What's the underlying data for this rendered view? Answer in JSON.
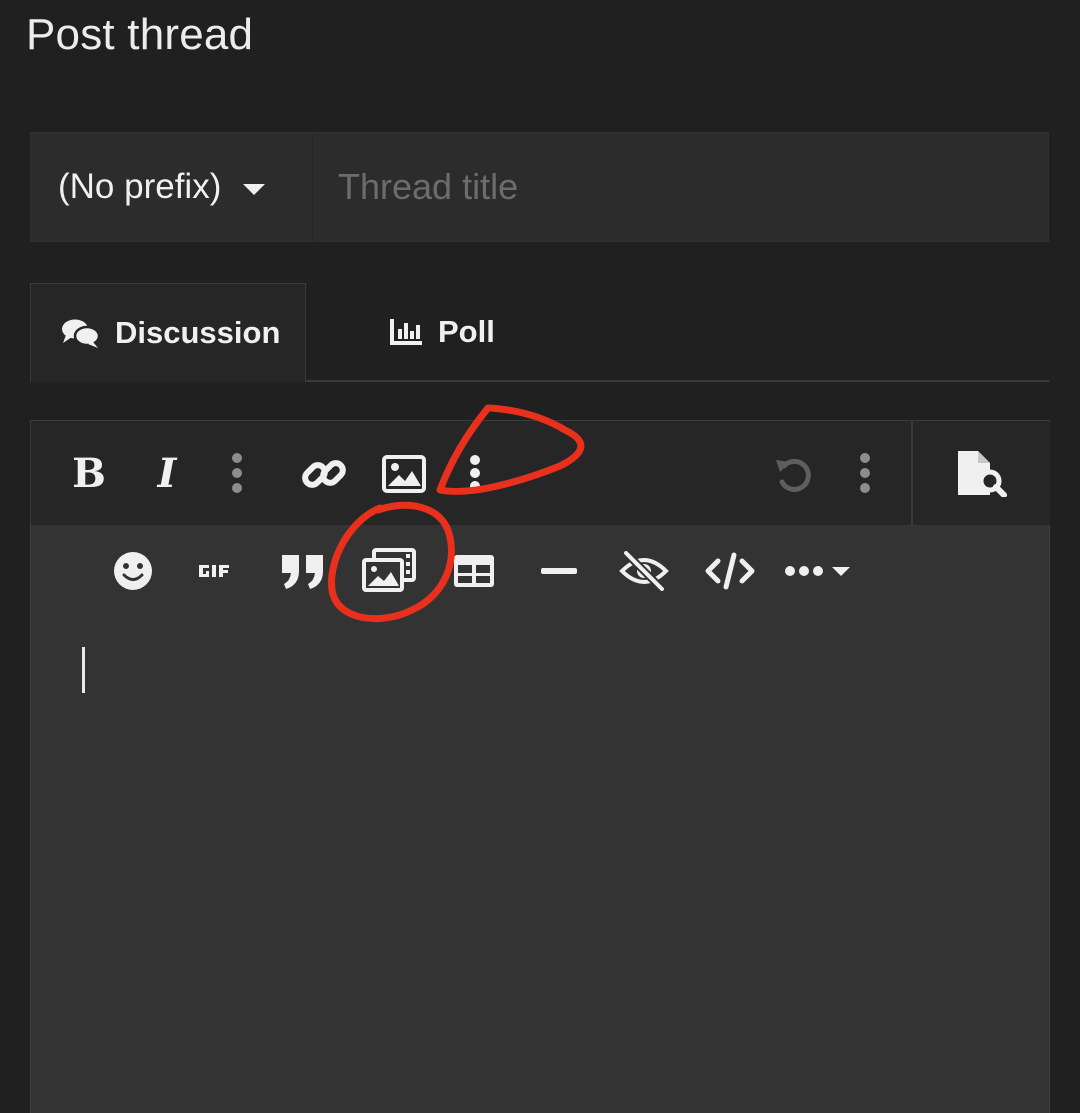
{
  "page": {
    "title": "Post thread"
  },
  "thread_form": {
    "prefix": {
      "selected": "(No prefix)"
    },
    "title_input": {
      "placeholder": "Thread title",
      "value": ""
    }
  },
  "tabs": [
    {
      "label": "Discussion",
      "icon": "comments-icon",
      "active": true
    },
    {
      "label": "Poll",
      "icon": "bar-chart-icon",
      "active": false
    }
  ],
  "editor": {
    "toolbar_primary": [
      "bold-icon",
      "italic-icon",
      "more-text-options-icon",
      "link-icon",
      "image-icon",
      "more-insert-options-icon",
      "undo-icon",
      "more-options-icon"
    ],
    "toolbar_secondary": [
      "emoji-icon",
      "gif-icon",
      "quote-icon",
      "media-gallery-icon",
      "table-icon",
      "horizontal-rule-icon",
      "spoiler-icon",
      "code-icon",
      "more-insert-icon"
    ],
    "preview_icon": "preview-icon",
    "content": ""
  },
  "annotations": {
    "color": "#e8301c"
  },
  "colors": {
    "background": "#202020",
    "panel": "#2c2c2c",
    "toolbar": "#262626",
    "editor": "#333333"
  }
}
